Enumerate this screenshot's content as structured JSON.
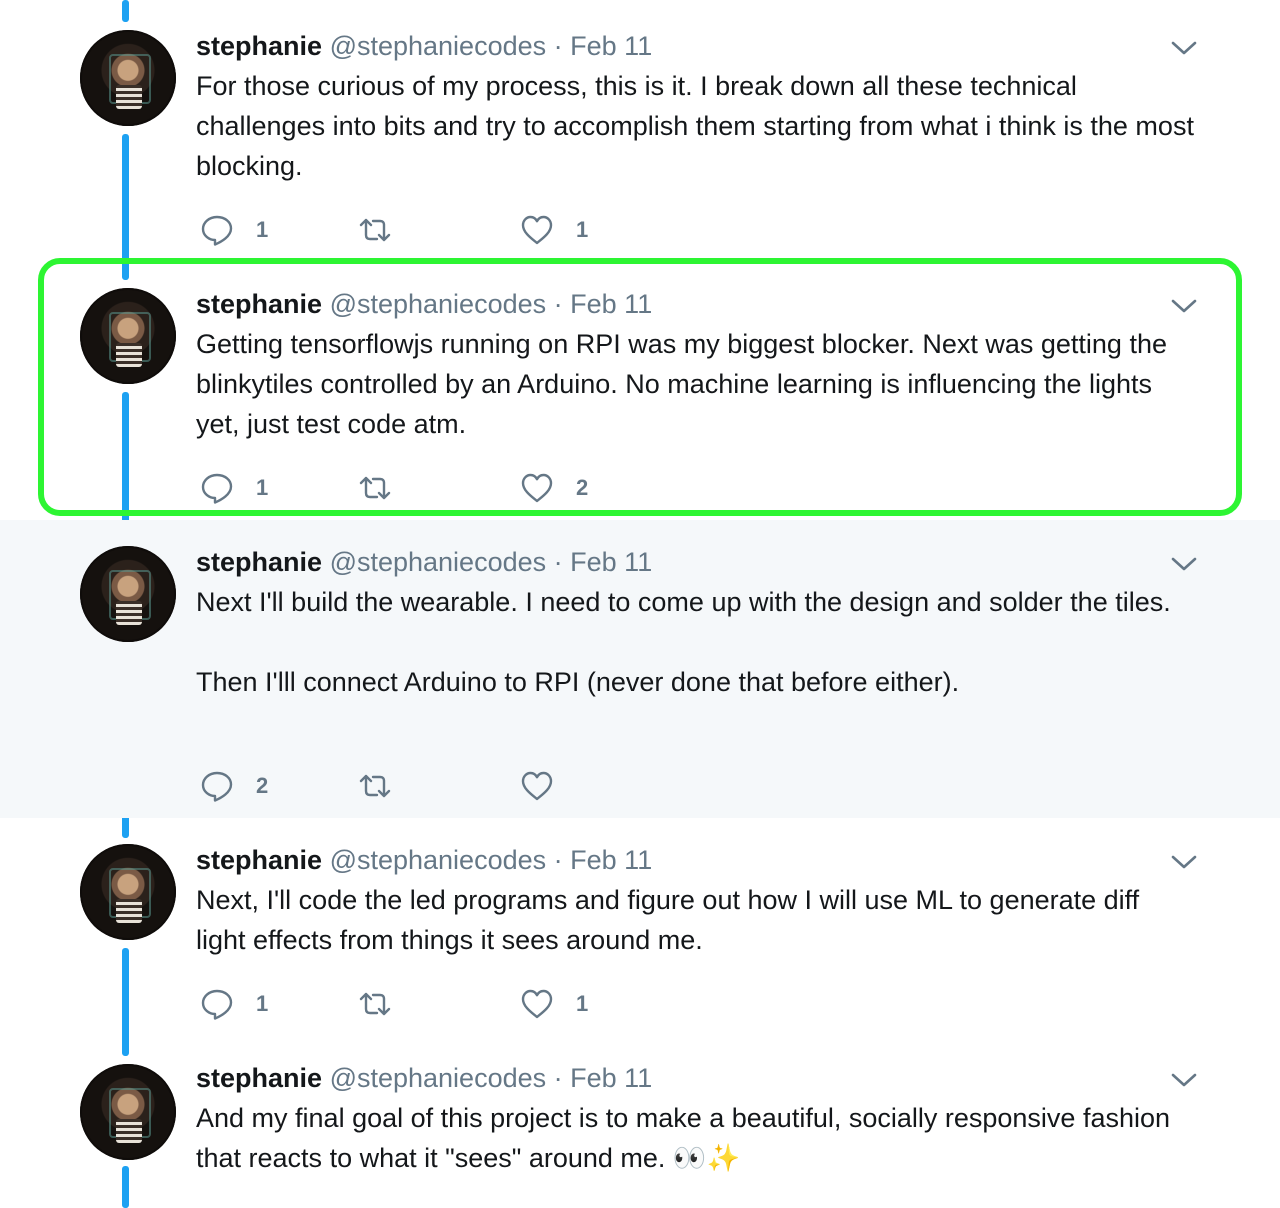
{
  "accent_color": "#1da1f2",
  "highlight_color": "#2df532",
  "tweets": [
    {
      "name": "stephanie",
      "handle": "@stephaniecodes",
      "separator": "·",
      "date": "Feb 11",
      "text": "For those curious of my process, this is it. I break down all these technical challenges into bits and try to accomplish them starting from what i think is the most blocking.",
      "reply_count": "1",
      "retweet_count": "",
      "like_count": "1"
    },
    {
      "name": "stephanie",
      "handle": "@stephaniecodes",
      "separator": "·",
      "date": "Feb 11",
      "text": "Getting tensorflowjs running on RPI was my biggest blocker. Next was getting the blinkytiles controlled by an Arduino. No machine learning is influencing the lights yet, just test code atm.",
      "reply_count": "1",
      "retweet_count": "",
      "like_count": "2",
      "highlighted": true
    },
    {
      "name": "stephanie",
      "handle": "@stephaniecodes",
      "separator": "·",
      "date": "Feb 11",
      "text": "Next I'll build the wearable. I need to come up with the design and solder the tiles.\n\nThen I'lll connect Arduino to RPI (never done that before either).",
      "reply_count": "2",
      "retweet_count": "",
      "like_count": ""
    },
    {
      "name": "stephanie",
      "handle": "@stephaniecodes",
      "separator": "·",
      "date": "Feb 11",
      "text": "Next, I'll code the led programs and figure out how I will use ML to generate diff light effects from things it sees around me.",
      "reply_count": "1",
      "retweet_count": "",
      "like_count": "1"
    },
    {
      "name": "stephanie",
      "handle": "@stephaniecodes",
      "separator": "·",
      "date": "Feb 11",
      "text": "And my final goal of this project is to make a beautiful, socially responsive fashion that reacts to what it \"sees\" around me. ",
      "emoji": "👀✨"
    }
  ],
  "icons": [
    "avatar",
    "chevron-down-icon",
    "reply-icon",
    "retweet-icon",
    "like-icon"
  ]
}
